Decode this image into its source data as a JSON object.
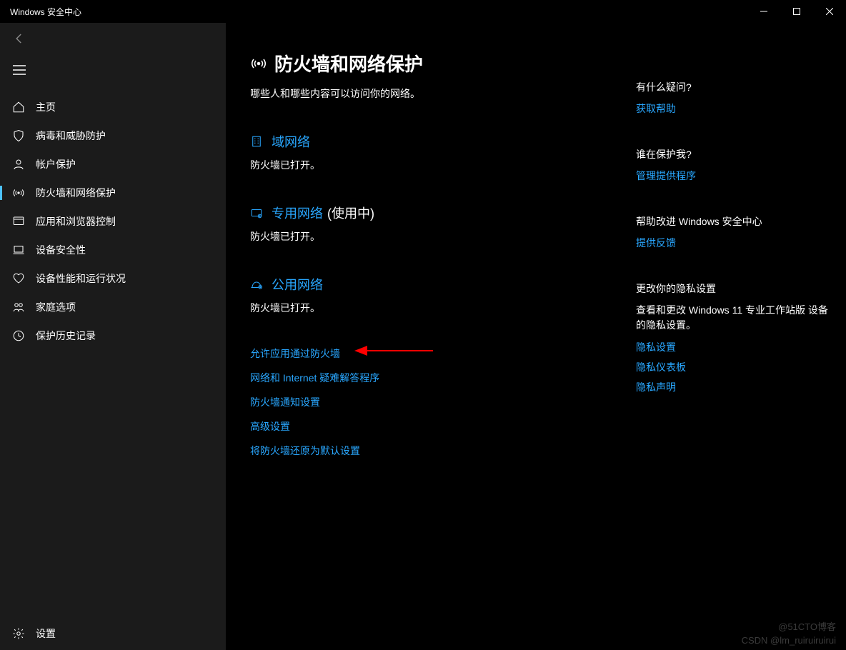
{
  "window": {
    "title": "Windows 安全中心"
  },
  "sidebar": {
    "items": [
      {
        "label": "主页"
      },
      {
        "label": "病毒和威胁防护"
      },
      {
        "label": "帐户保护"
      },
      {
        "label": "防火墙和网络保护"
      },
      {
        "label": "应用和浏览器控制"
      },
      {
        "label": "设备安全性"
      },
      {
        "label": "设备性能和运行状况"
      },
      {
        "label": "家庭选项"
      },
      {
        "label": "保护历史记录"
      }
    ],
    "settings": "设置"
  },
  "page": {
    "title": "防火墙和网络保护",
    "subtitle": "哪些人和哪些内容可以访问你的网络。"
  },
  "networks": [
    {
      "label": "域网络",
      "suffix": "",
      "status": "防火墙已打开。"
    },
    {
      "label": "专用网络",
      "suffix": "(使用中)",
      "status": "防火墙已打开。"
    },
    {
      "label": "公用网络",
      "suffix": "",
      "status": "防火墙已打开。"
    }
  ],
  "fwlinks": [
    "允许应用通过防火墙",
    "网络和 Internet 疑难解答程序",
    "防火墙通知设置",
    "高级设置",
    "将防火墙还原为默认设置"
  ],
  "right": {
    "sec1": {
      "title": "有什么疑问?",
      "link": "获取帮助"
    },
    "sec2": {
      "title": "谁在保护我?",
      "link": "管理提供程序"
    },
    "sec3": {
      "title": "帮助改进 Windows 安全中心",
      "link": "提供反馈"
    },
    "sec4": {
      "title": "更改你的隐私设置",
      "text": "查看和更改 Windows 11 专业工作站版 设备的隐私设置。",
      "links": [
        "隐私设置",
        "隐私仪表板",
        "隐私声明"
      ]
    }
  },
  "watermarks": {
    "w1": "@51CTO博客",
    "w2": "CSDN @lm_ruiruiruirui"
  }
}
